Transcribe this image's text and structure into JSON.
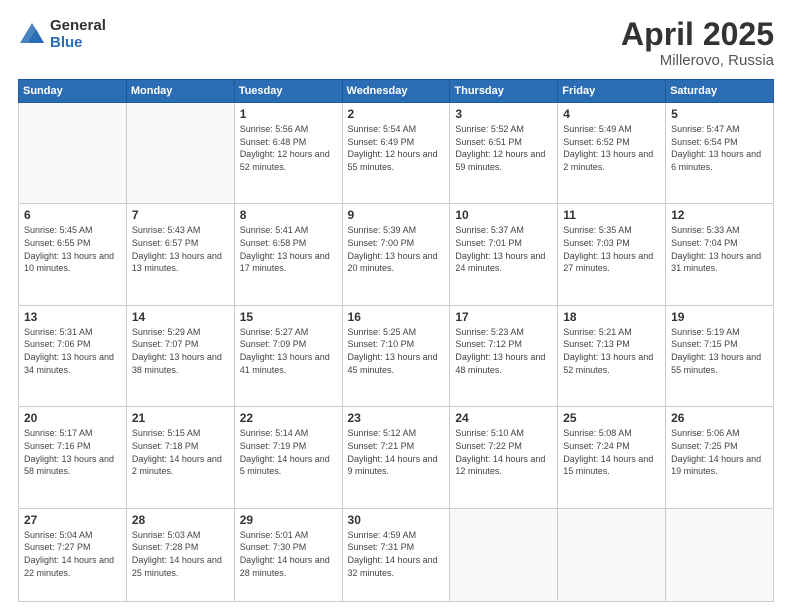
{
  "header": {
    "logo_general": "General",
    "logo_blue": "Blue",
    "title": "April 2025",
    "location": "Millerovo, Russia"
  },
  "weekdays": [
    "Sunday",
    "Monday",
    "Tuesday",
    "Wednesday",
    "Thursday",
    "Friday",
    "Saturday"
  ],
  "weeks": [
    [
      {
        "day": "",
        "info": ""
      },
      {
        "day": "",
        "info": ""
      },
      {
        "day": "1",
        "info": "Sunrise: 5:56 AM\nSunset: 6:48 PM\nDaylight: 12 hours\nand 52 minutes."
      },
      {
        "day": "2",
        "info": "Sunrise: 5:54 AM\nSunset: 6:49 PM\nDaylight: 12 hours\nand 55 minutes."
      },
      {
        "day": "3",
        "info": "Sunrise: 5:52 AM\nSunset: 6:51 PM\nDaylight: 12 hours\nand 59 minutes."
      },
      {
        "day": "4",
        "info": "Sunrise: 5:49 AM\nSunset: 6:52 PM\nDaylight: 13 hours\nand 2 minutes."
      },
      {
        "day": "5",
        "info": "Sunrise: 5:47 AM\nSunset: 6:54 PM\nDaylight: 13 hours\nand 6 minutes."
      }
    ],
    [
      {
        "day": "6",
        "info": "Sunrise: 5:45 AM\nSunset: 6:55 PM\nDaylight: 13 hours\nand 10 minutes."
      },
      {
        "day": "7",
        "info": "Sunrise: 5:43 AM\nSunset: 6:57 PM\nDaylight: 13 hours\nand 13 minutes."
      },
      {
        "day": "8",
        "info": "Sunrise: 5:41 AM\nSunset: 6:58 PM\nDaylight: 13 hours\nand 17 minutes."
      },
      {
        "day": "9",
        "info": "Sunrise: 5:39 AM\nSunset: 7:00 PM\nDaylight: 13 hours\nand 20 minutes."
      },
      {
        "day": "10",
        "info": "Sunrise: 5:37 AM\nSunset: 7:01 PM\nDaylight: 13 hours\nand 24 minutes."
      },
      {
        "day": "11",
        "info": "Sunrise: 5:35 AM\nSunset: 7:03 PM\nDaylight: 13 hours\nand 27 minutes."
      },
      {
        "day": "12",
        "info": "Sunrise: 5:33 AM\nSunset: 7:04 PM\nDaylight: 13 hours\nand 31 minutes."
      }
    ],
    [
      {
        "day": "13",
        "info": "Sunrise: 5:31 AM\nSunset: 7:06 PM\nDaylight: 13 hours\nand 34 minutes."
      },
      {
        "day": "14",
        "info": "Sunrise: 5:29 AM\nSunset: 7:07 PM\nDaylight: 13 hours\nand 38 minutes."
      },
      {
        "day": "15",
        "info": "Sunrise: 5:27 AM\nSunset: 7:09 PM\nDaylight: 13 hours\nand 41 minutes."
      },
      {
        "day": "16",
        "info": "Sunrise: 5:25 AM\nSunset: 7:10 PM\nDaylight: 13 hours\nand 45 minutes."
      },
      {
        "day": "17",
        "info": "Sunrise: 5:23 AM\nSunset: 7:12 PM\nDaylight: 13 hours\nand 48 minutes."
      },
      {
        "day": "18",
        "info": "Sunrise: 5:21 AM\nSunset: 7:13 PM\nDaylight: 13 hours\nand 52 minutes."
      },
      {
        "day": "19",
        "info": "Sunrise: 5:19 AM\nSunset: 7:15 PM\nDaylight: 13 hours\nand 55 minutes."
      }
    ],
    [
      {
        "day": "20",
        "info": "Sunrise: 5:17 AM\nSunset: 7:16 PM\nDaylight: 13 hours\nand 58 minutes."
      },
      {
        "day": "21",
        "info": "Sunrise: 5:15 AM\nSunset: 7:18 PM\nDaylight: 14 hours\nand 2 minutes."
      },
      {
        "day": "22",
        "info": "Sunrise: 5:14 AM\nSunset: 7:19 PM\nDaylight: 14 hours\nand 5 minutes."
      },
      {
        "day": "23",
        "info": "Sunrise: 5:12 AM\nSunset: 7:21 PM\nDaylight: 14 hours\nand 9 minutes."
      },
      {
        "day": "24",
        "info": "Sunrise: 5:10 AM\nSunset: 7:22 PM\nDaylight: 14 hours\nand 12 minutes."
      },
      {
        "day": "25",
        "info": "Sunrise: 5:08 AM\nSunset: 7:24 PM\nDaylight: 14 hours\nand 15 minutes."
      },
      {
        "day": "26",
        "info": "Sunrise: 5:06 AM\nSunset: 7:25 PM\nDaylight: 14 hours\nand 19 minutes."
      }
    ],
    [
      {
        "day": "27",
        "info": "Sunrise: 5:04 AM\nSunset: 7:27 PM\nDaylight: 14 hours\nand 22 minutes."
      },
      {
        "day": "28",
        "info": "Sunrise: 5:03 AM\nSunset: 7:28 PM\nDaylight: 14 hours\nand 25 minutes."
      },
      {
        "day": "29",
        "info": "Sunrise: 5:01 AM\nSunset: 7:30 PM\nDaylight: 14 hours\nand 28 minutes."
      },
      {
        "day": "30",
        "info": "Sunrise: 4:59 AM\nSunset: 7:31 PM\nDaylight: 14 hours\nand 32 minutes."
      },
      {
        "day": "",
        "info": ""
      },
      {
        "day": "",
        "info": ""
      },
      {
        "day": "",
        "info": ""
      }
    ]
  ]
}
